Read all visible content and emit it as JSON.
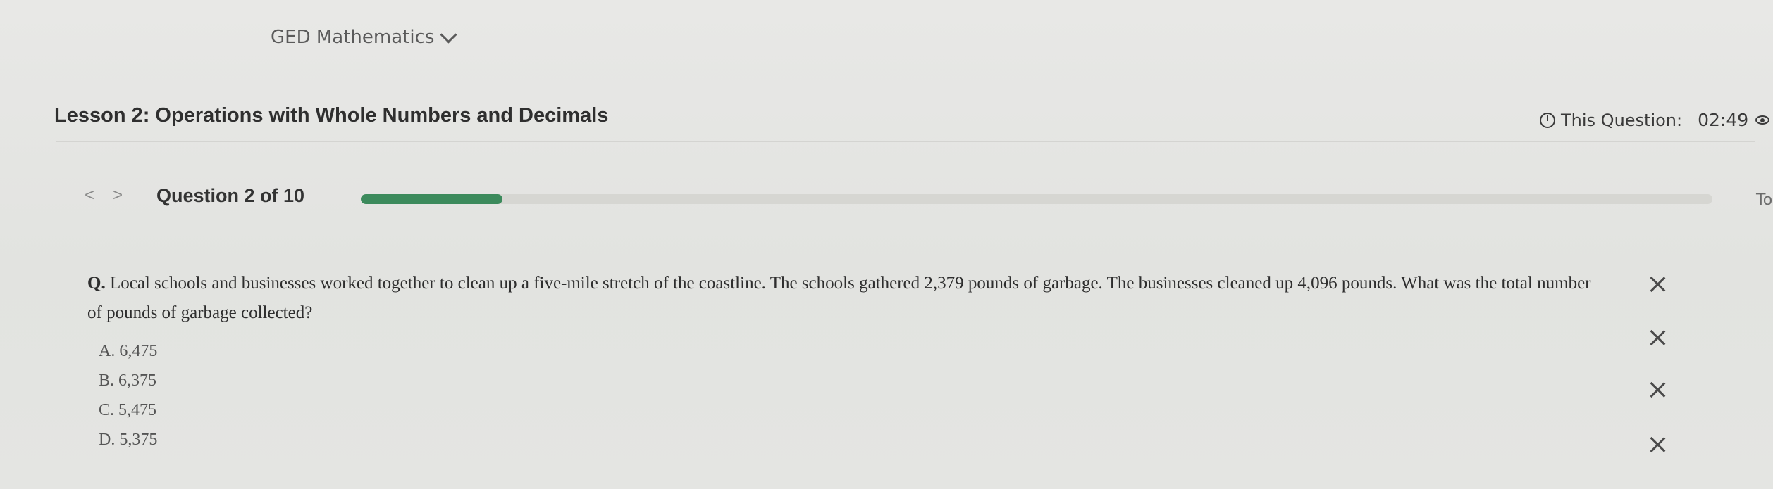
{
  "course": {
    "title": "GED Mathematics"
  },
  "lesson": {
    "title": "Lesson 2: Operations with Whole Numbers and Decimals"
  },
  "timer": {
    "label": "This Question:",
    "value": "02:49"
  },
  "navigation": {
    "prev_symbol": "<",
    "next_symbol": ">",
    "question_counter": "Question 2 of 10",
    "progress_fraction": 0.105,
    "edge_text": "To"
  },
  "question": {
    "prefix": "Q.",
    "text": "Local schools and businesses worked together to clean up a five-mile stretch of the coastline. The schools gathered 2,379 pounds of garbage. The businesses cleaned up 4,096 pounds. What was the total number of pounds of garbage collected?"
  },
  "options": [
    {
      "letter": "A.",
      "value": "6,475"
    },
    {
      "letter": "B.",
      "value": "6,375"
    },
    {
      "letter": "C.",
      "value": "5,475"
    },
    {
      "letter": "D.",
      "value": "5,375"
    }
  ],
  "colors": {
    "progress_fill": "#3c8a5c",
    "progress_track": "#d6d6d2",
    "background": "#e4e5e2"
  },
  "icons": [
    "chevron-down-icon",
    "timer-icon",
    "eye-icon",
    "close-icon"
  ]
}
